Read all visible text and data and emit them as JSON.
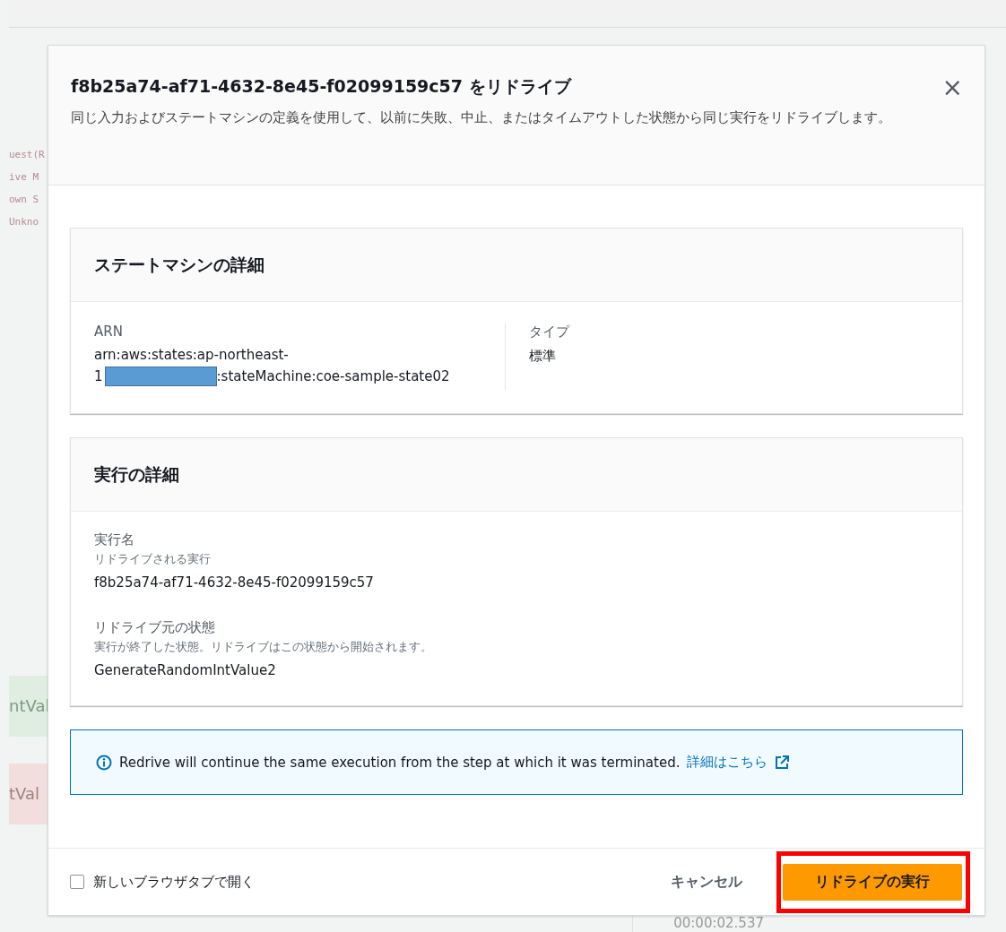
{
  "background": {
    "code_lines": [
      "uest(R",
      "ive M",
      "own S",
      "Unkno"
    ],
    "states": [
      {
        "label": "ntVal",
        "kind": "succeeded"
      },
      {
        "label": "tVal",
        "kind": "failed"
      }
    ],
    "elapsed": "00:00:02.537"
  },
  "dialog": {
    "title": "f8b25a74-af71-4632-8e45-f02099159c57 をリドライブ",
    "description": "同じ入力およびステートマシンの定義を使用して、以前に失敗、中止、またはタイムアウトした状態から同じ実行をリドライブします。",
    "close": "×",
    "state_machine": {
      "heading": "ステートマシンの詳細",
      "arn": {
        "label": "ARN",
        "line_1": "arn:aws:states:ap-northeast-",
        "line_2_start": "1",
        "redacted": true,
        "line_2_end": ":stateMachine:coe-sample-state02"
      },
      "type": {
        "label": "タイプ",
        "value": "標準"
      }
    },
    "execution": {
      "heading": "実行の詳細",
      "fields": [
        {
          "label": "実行名",
          "hint": "リドライブされる実行",
          "value": "f8b25a74-af71-4632-8e45-f02099159c57"
        },
        {
          "label": "リドライブ元の状態",
          "hint": "実行が終了した状態。リドライブはこの状態から開始されます。",
          "value": "GenerateRandomIntValue2"
        }
      ]
    },
    "info": {
      "text": "Redrive will continue the same execution from the step at which it was terminated.",
      "link": "詳細はこちら"
    },
    "new_tab": {
      "label": "新しいブラウザタブで開く",
      "checked": false
    },
    "buttons": [
      {
        "label": "キャンセル",
        "kind": "link",
        "highlighted": false
      },
      {
        "label": "リドライブの実行",
        "kind": "primary",
        "highlighted": true
      }
    ]
  }
}
